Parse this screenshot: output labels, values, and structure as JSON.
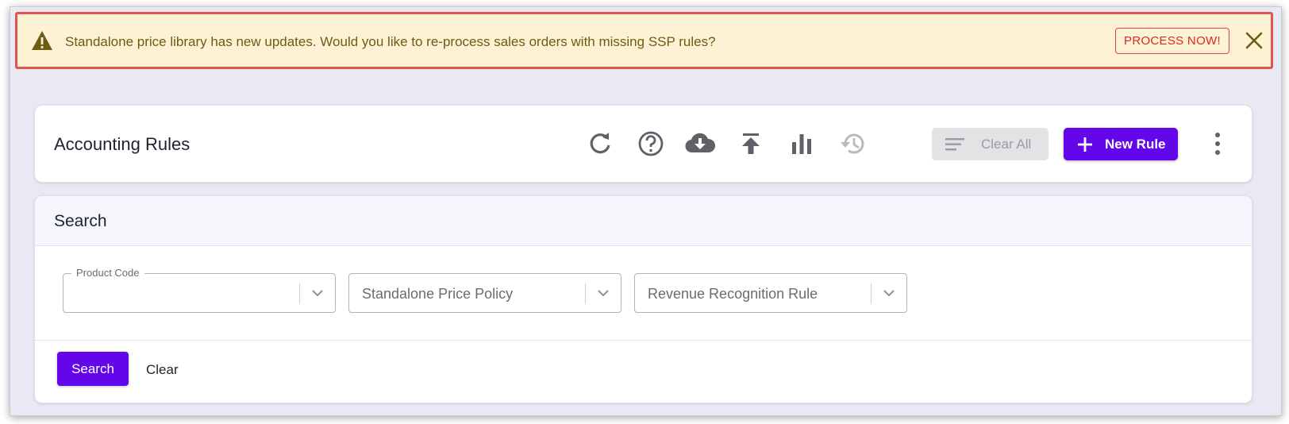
{
  "banner": {
    "message": "Standalone price library has new updates. Would you like to re-process sales orders with missing SSP rules?",
    "action_label": "PROCESS NOW!",
    "icon": "warning-icon",
    "close_icon": "close-icon"
  },
  "header": {
    "title": "Accounting Rules",
    "toolbar_icons": [
      "refresh-icon",
      "help-icon",
      "cloud-download-icon",
      "upload-icon",
      "bar-chart-icon",
      "history-icon"
    ],
    "clear_all_label": "Clear All",
    "new_rule_label": "New Rule"
  },
  "search": {
    "title": "Search",
    "fields": {
      "product_code": {
        "label": "Product Code",
        "value": ""
      },
      "standalone_price_policy": {
        "placeholder": "Standalone Price Policy"
      },
      "revenue_recognition_rule": {
        "placeholder": "Revenue Recognition Rule"
      }
    },
    "search_label": "Search",
    "clear_label": "Clear"
  },
  "colors": {
    "primary": "#6306ea",
    "banner_bg": "#fdf2d3",
    "banner_border": "#e2544f",
    "banner_text": "#6e5b14",
    "action_red": "#d32d24",
    "page_bg": "#e8e9f3"
  }
}
